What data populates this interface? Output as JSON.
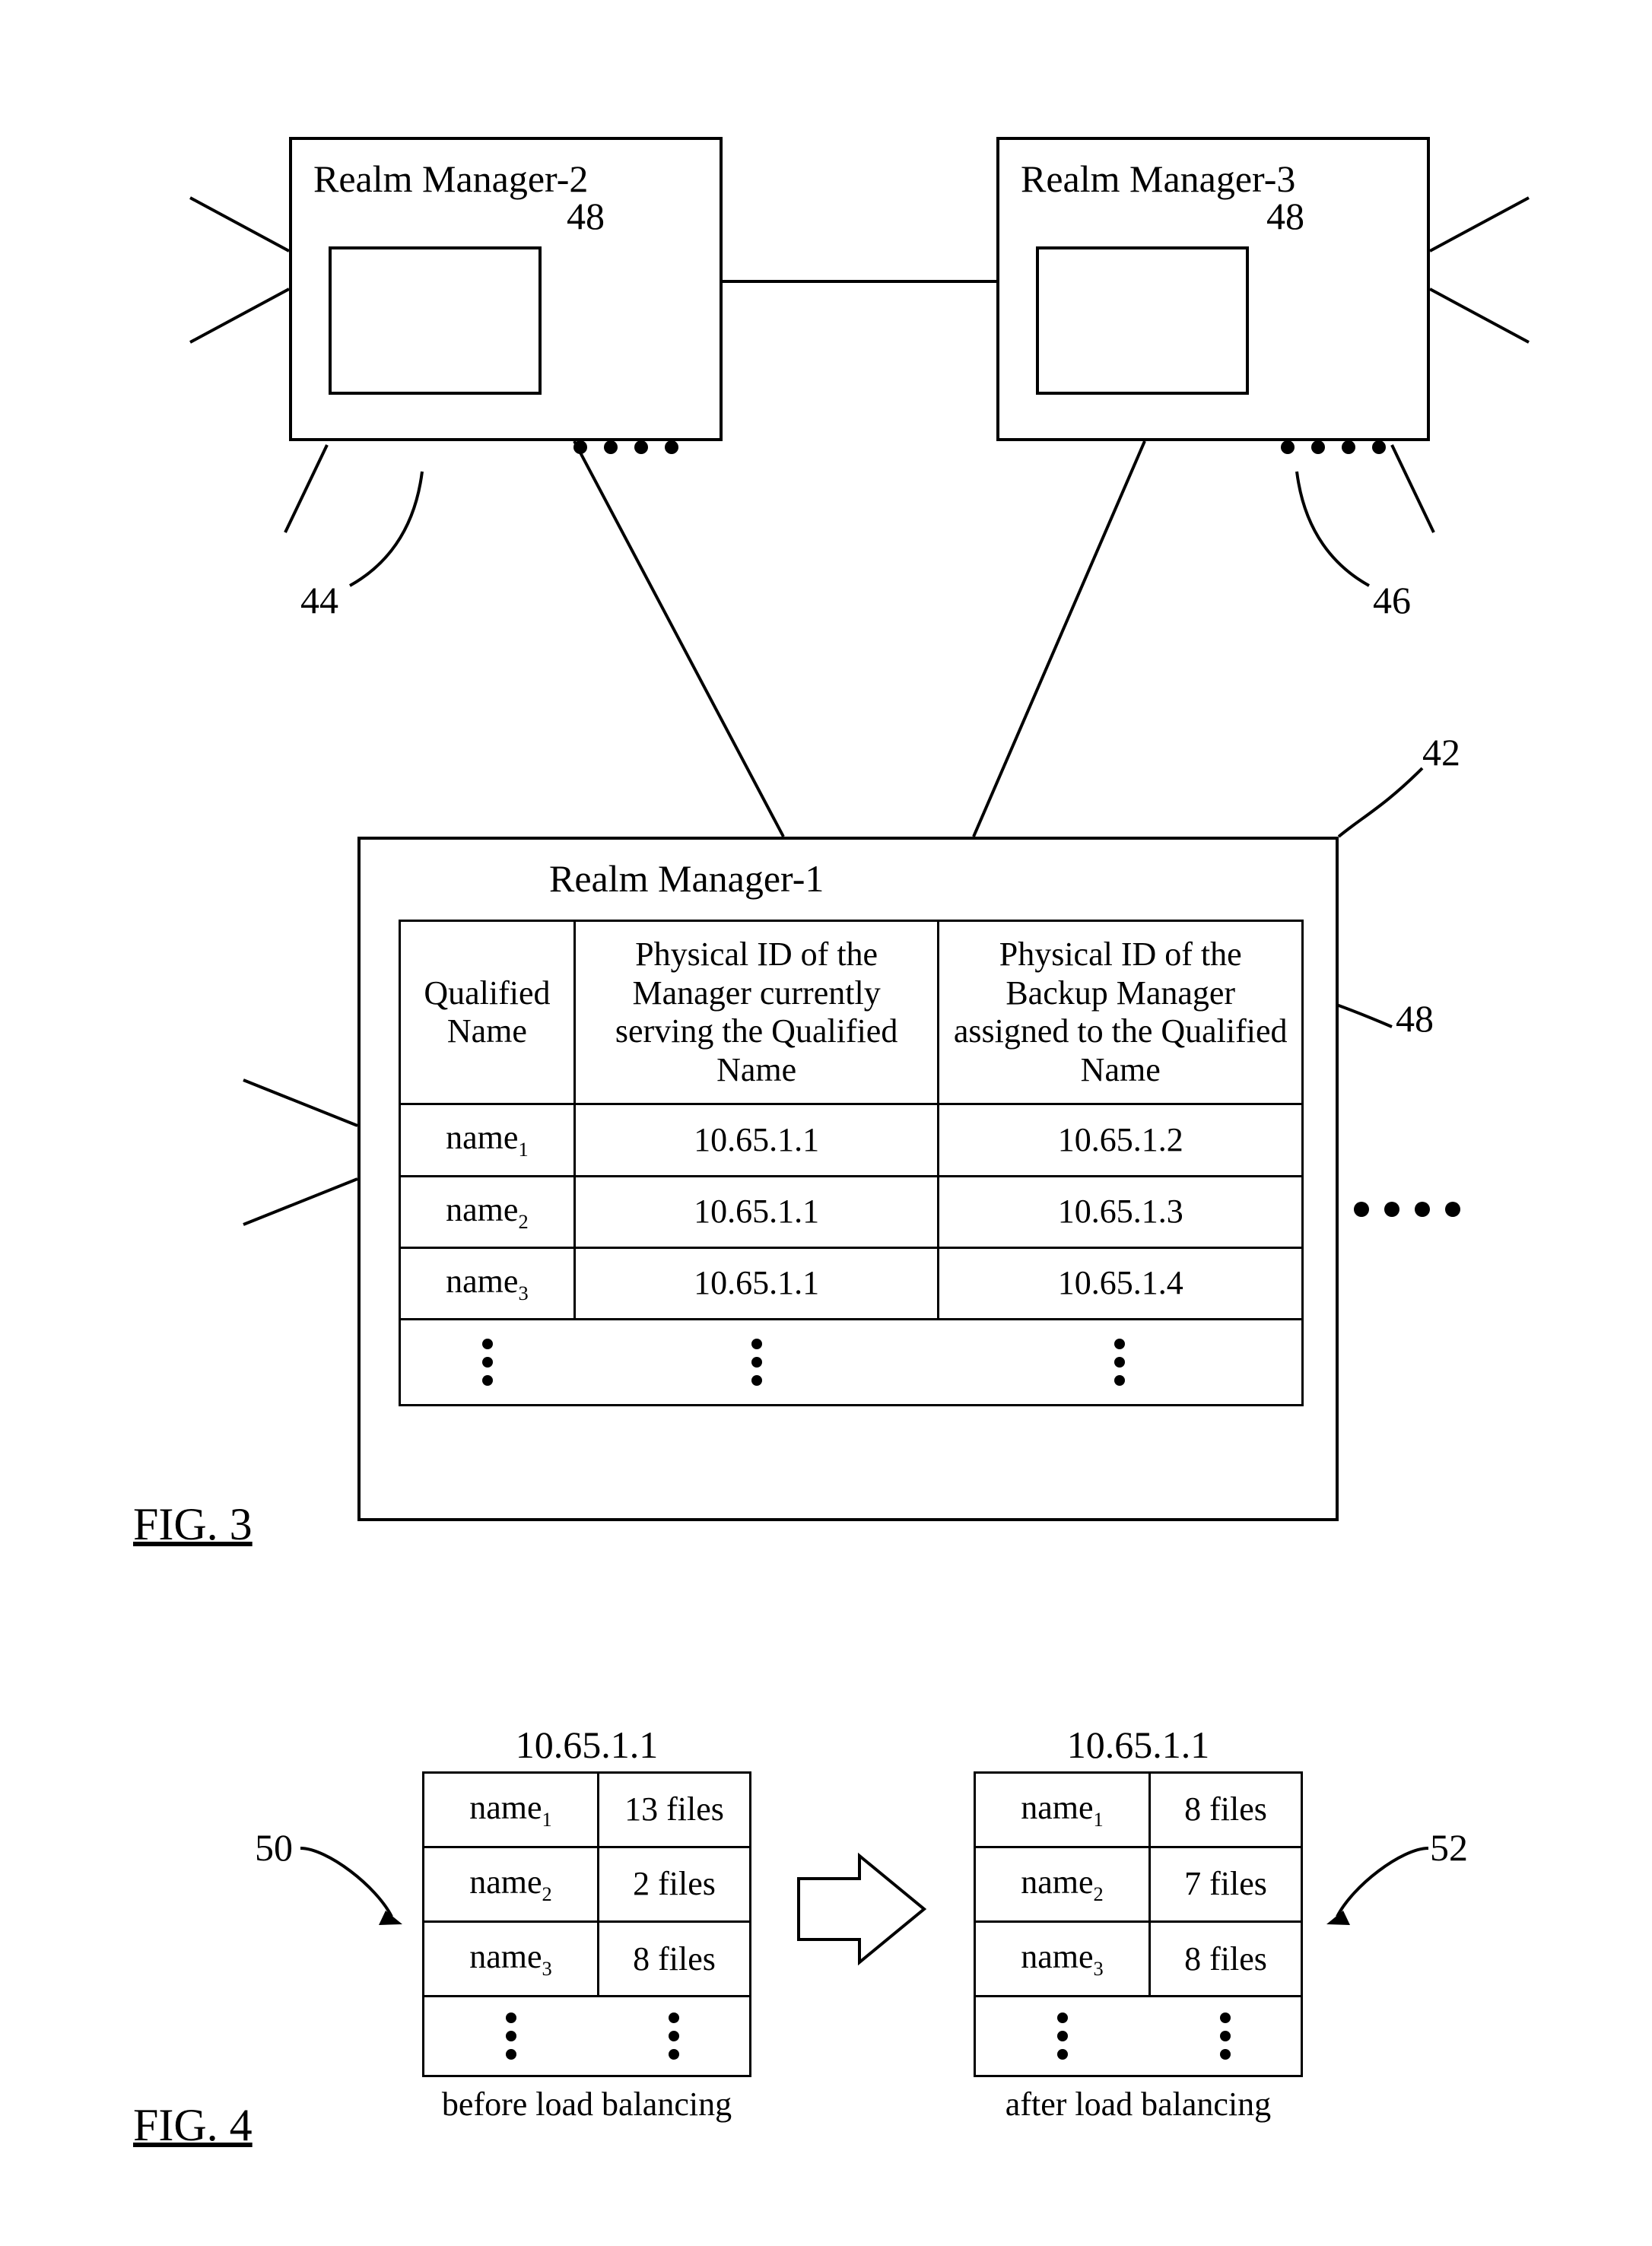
{
  "fig3": {
    "label": "FIG. 3",
    "rm2": {
      "title": "Realm Manager-2",
      "ref": "44",
      "inner_ref": "48"
    },
    "rm3": {
      "title": "Realm Manager-3",
      "ref": "46",
      "inner_ref": "48"
    },
    "rm1": {
      "title": "Realm Manager-1",
      "ref": "42",
      "table_ref": "48",
      "headers": {
        "c1": "Qualified Name",
        "c2": "Physical ID of the Manager currently serving the Qualified Name",
        "c3": "Physical ID of the Backup Manager assigned to the Qualified Name"
      },
      "rows": [
        {
          "name": "name",
          "sub": "1",
          "ip1": "10.65.1.1",
          "ip2": "10.65.1.2"
        },
        {
          "name": "name",
          "sub": "2",
          "ip1": "10.65.1.1",
          "ip2": "10.65.1.3"
        },
        {
          "name": "name",
          "sub": "3",
          "ip1": "10.65.1.1",
          "ip2": "10.65.1.4"
        }
      ]
    }
  },
  "fig4": {
    "label": "FIG. 4",
    "ip": "10.65.1.1",
    "before": {
      "ref": "50",
      "caption": "before load balancing",
      "rows": [
        {
          "name": "name",
          "sub": "1",
          "files": "13 files"
        },
        {
          "name": "name",
          "sub": "2",
          "files": "2 files"
        },
        {
          "name": "name",
          "sub": "3",
          "files": "8 files"
        }
      ]
    },
    "after": {
      "ref": "52",
      "caption": "after load balancing",
      "rows": [
        {
          "name": "name",
          "sub": "1",
          "files": "8 files"
        },
        {
          "name": "name",
          "sub": "2",
          "files": "7 files"
        },
        {
          "name": "name",
          "sub": "3",
          "files": "8 files"
        }
      ]
    }
  }
}
